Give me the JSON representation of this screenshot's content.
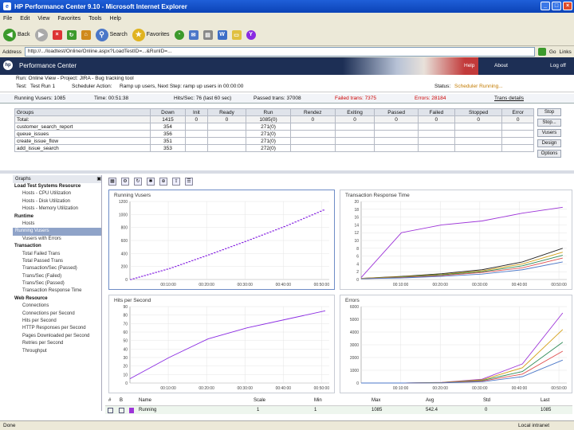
{
  "window": {
    "title": "HP Performance Center 9.10 - Microsoft Internet Explorer"
  },
  "menu": [
    "File",
    "Edit",
    "View",
    "Favorites",
    "Tools",
    "Help"
  ],
  "toolbar": {
    "back": "Back",
    "search": "Search",
    "favorites": "Favorites"
  },
  "address": {
    "label": "Address",
    "value": "http://.../loadtest/Online/Online.aspx?LoadTestID=...&RunID=...",
    "go": "Go",
    "links": "Links"
  },
  "pc": {
    "title": "Performance Center",
    "help": "Help",
    "about": "About",
    "logout": "Log off"
  },
  "info": {
    "test_label": "Test:",
    "test_value": "Test Run 1",
    "scheduler_label": "Scheduler Action:",
    "scheduler_value": "Ramp up users, Next Step: ramp up users in 00:00:00",
    "status_label": "Status:",
    "status_value": "Scheduler Running...",
    "header_line": "Run: Online View - Project: JIRA - Bug tracking tool"
  },
  "stats": {
    "running": "Running Vusers: 1085",
    "time": "Time: 00:51:38",
    "hits": "Hits/Sec: 76 (last 60 sec)",
    "passed": "Passed trans: 37008",
    "failed": "Failed trans: 7375",
    "errors": "Errors: 28184",
    "details": "Trans details"
  },
  "groups": {
    "columns": [
      "Groups",
      "Down",
      "Init",
      "Ready",
      "Run",
      "Rendez",
      "Exiting",
      "Passed",
      "Failed",
      "Stopped",
      "Error"
    ],
    "rows": [
      [
        "Total:",
        "1415",
        "0",
        "0",
        "1085(0)",
        "0",
        "0",
        "0",
        "0",
        "0",
        "0"
      ],
      [
        "customer_search_report",
        "354",
        "",
        "",
        "271(0)",
        "",
        "",
        "",
        "",
        "",
        ""
      ],
      [
        "queue_issues",
        "356",
        "",
        "",
        "271(0)",
        "",
        "",
        "",
        "",
        "",
        ""
      ],
      [
        "create_issue_flow",
        "351",
        "",
        "",
        "271(0)",
        "",
        "",
        "",
        "",
        "",
        ""
      ],
      [
        "add_issue_search",
        "353",
        "",
        "",
        "272(0)",
        "",
        "",
        "",
        "",
        "",
        ""
      ]
    ]
  },
  "side_buttons": [
    "Stop",
    "Stop...",
    "Vusers",
    "Design",
    "Options"
  ],
  "nav": {
    "header": "Graphs",
    "items": [
      {
        "label": "Load Test Systems Resource",
        "kind": "cat"
      },
      {
        "label": "Hosts - CPU Utilization",
        "kind": "sub"
      },
      {
        "label": "Hosts - Disk Utilization",
        "kind": "sub"
      },
      {
        "label": "Hosts - Memory Utilization",
        "kind": "sub"
      },
      {
        "label": "Runtime",
        "kind": "cat"
      },
      {
        "label": "Hosts",
        "kind": "sub"
      },
      {
        "label": "Running Vusers",
        "kind": "sel"
      },
      {
        "label": "Vusers with Errors",
        "kind": "sub"
      },
      {
        "label": "Transaction",
        "kind": "cat"
      },
      {
        "label": "Total Failed Trans",
        "kind": "sub"
      },
      {
        "label": "Total Passed Trans",
        "kind": "sub"
      },
      {
        "label": "Transaction/Sec (Passed)",
        "kind": "sub"
      },
      {
        "label": "Trans/Sec (Failed)",
        "kind": "sub"
      },
      {
        "label": "Trans/Sec (Passed)",
        "kind": "sub"
      },
      {
        "label": "Transaction Response Time",
        "kind": "sub"
      },
      {
        "label": "Web Resource",
        "kind": "cat"
      },
      {
        "label": "Connections",
        "kind": "sub"
      },
      {
        "label": "Connections per Second",
        "kind": "sub"
      },
      {
        "label": "Hits per Second",
        "kind": "sub"
      },
      {
        "label": "HTTP Responses per Second",
        "kind": "sub"
      },
      {
        "label": "Pages Downloaded per Second",
        "kind": "sub"
      },
      {
        "label": "Retries per Second",
        "kind": "sub"
      },
      {
        "label": "Throughput",
        "kind": "sub"
      }
    ]
  },
  "graphs": {
    "running_vusers": {
      "title": "Running Vusers",
      "yticks": [
        "1200",
        "1000",
        "800",
        "600",
        "400",
        "200",
        "0"
      ],
      "xticks": [
        "00:10:00",
        "00:20:00",
        "00:30:00",
        "00:40:00",
        "00:50:00"
      ]
    },
    "trt": {
      "title": "Transaction Response Time",
      "yticks": [
        "20",
        "18",
        "16",
        "14",
        "12",
        "10",
        "8",
        "6",
        "4",
        "2",
        "0"
      ],
      "xticks": [
        "00:10:00",
        "00:20:00",
        "00:30:00",
        "00:40:00",
        "00:50:00"
      ]
    },
    "hits": {
      "title": "Hits per Second",
      "yticks": [
        "90",
        "80",
        "70",
        "60",
        "50",
        "40",
        "30",
        "20",
        "10",
        "0"
      ],
      "xticks": [
        "00:10:00",
        "00:20:00",
        "00:30:00",
        "00:40:00",
        "00:50:00"
      ]
    },
    "errors": {
      "title": "Errors",
      "yticks": [
        "6000",
        "5000",
        "4000",
        "3000",
        "2000",
        "1000",
        "0"
      ],
      "xticks": [
        "00:10:00",
        "00:20:00",
        "00:30:00",
        "00:40:00",
        "00:50:00"
      ]
    }
  },
  "chart_data": [
    {
      "type": "line",
      "title": "Running Vusers",
      "ylim": [
        0,
        1200
      ],
      "x": [
        "00:00",
        "00:10:00",
        "00:20:00",
        "00:30:00",
        "00:40:00",
        "00:50:00"
      ],
      "series": [
        {
          "color": "#8a2be2",
          "values": [
            0,
            170,
            380,
            600,
            830,
            1085
          ]
        }
      ]
    },
    {
      "type": "line",
      "title": "Transaction Response Time",
      "ylim": [
        0,
        20
      ],
      "x": [
        "00:00",
        "00:10:00",
        "00:20:00",
        "00:30:00",
        "00:40:00",
        "00:50:00"
      ],
      "series": [
        {
          "color": "#9d34d8",
          "values": [
            0.5,
            12,
            14,
            15,
            17,
            18.5
          ]
        },
        {
          "color": "#222222",
          "values": [
            0.3,
            0.8,
            1.5,
            2.5,
            4.5,
            8
          ]
        },
        {
          "color": "#d4a017",
          "values": [
            0.3,
            0.7,
            1.3,
            2.2,
            4.0,
            7
          ]
        },
        {
          "color": "#2e8b57",
          "values": [
            0.2,
            0.6,
            1.2,
            2.0,
            3.5,
            6.2
          ]
        },
        {
          "color": "#e05050",
          "values": [
            0.2,
            0.5,
            1.0,
            1.8,
            3.0,
            5.5
          ]
        },
        {
          "color": "#4b77c8",
          "values": [
            0.2,
            0.4,
            0.8,
            1.4,
            2.5,
            4.5
          ]
        }
      ]
    },
    {
      "type": "line",
      "title": "Hits per Second",
      "ylim": [
        0,
        90
      ],
      "x": [
        "00:00",
        "00:10:00",
        "00:20:00",
        "00:30:00",
        "00:40:00",
        "00:50:00"
      ],
      "series": [
        {
          "color": "#8a2be2",
          "values": [
            5,
            30,
            52,
            65,
            75,
            85
          ]
        }
      ]
    },
    {
      "type": "line",
      "title": "Errors",
      "ylim": [
        0,
        6000
      ],
      "x": [
        "00:00",
        "00:10:00",
        "00:20:00",
        "00:30:00",
        "00:40:00",
        "00:50:00"
      ],
      "series": [
        {
          "color": "#9d34d8",
          "values": [
            0,
            0,
            50,
            300,
            1500,
            5500
          ]
        },
        {
          "color": "#d4a017",
          "values": [
            0,
            0,
            40,
            250,
            1200,
            4200
          ]
        },
        {
          "color": "#2e8b57",
          "values": [
            0,
            0,
            30,
            200,
            900,
            3200
          ]
        },
        {
          "color": "#e05050",
          "values": [
            0,
            0,
            20,
            150,
            700,
            2500
          ]
        },
        {
          "color": "#4b77c8",
          "values": [
            0,
            0,
            10,
            100,
            500,
            1800
          ]
        }
      ]
    }
  ],
  "bottom_table": {
    "headers": [
      "#",
      "B",
      "Scale",
      "Min",
      "Avg",
      "Max",
      "Std",
      "Last",
      "Name"
    ],
    "row": {
      "name": "Running",
      "scale": "1",
      "min": "1",
      "avg": "542.4",
      "max": "1085",
      "std": "0",
      "last": "1085"
    }
  },
  "statusbar": {
    "left": "Done",
    "right": "Local intranet"
  },
  "colors": {
    "accent": "#1d2f55",
    "ie_blue": "#0b43b7",
    "series_main": "#8a2be2"
  }
}
